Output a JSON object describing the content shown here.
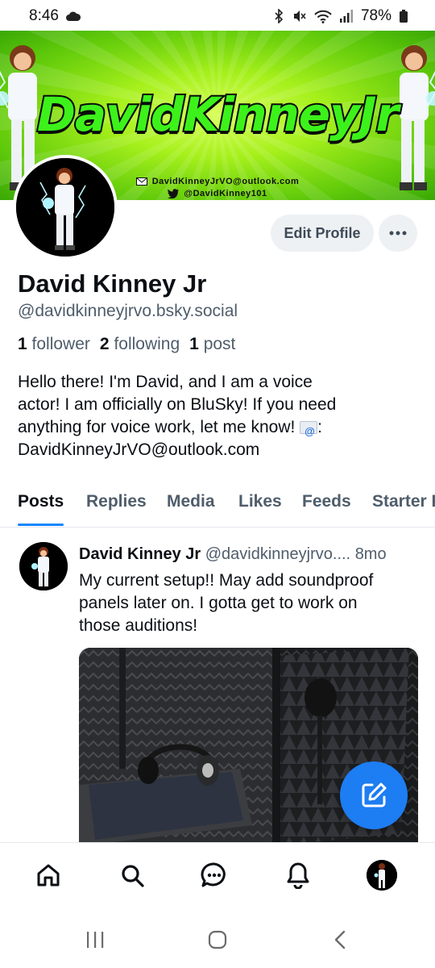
{
  "status_bar": {
    "time": "8:46",
    "battery": "78%",
    "icons": [
      "cloud-icon",
      "bluetooth-icon",
      "mute-icon",
      "wifi-icon",
      "signal-icon",
      "battery-icon"
    ]
  },
  "banner": {
    "title": "DavidKinneyJr",
    "email_line": "DavidKinneyJrVO@outlook.com",
    "twitter_line": "@DavidKinney101",
    "colors": {
      "primary_green": "#3df21a",
      "background": "#a6f01c"
    }
  },
  "profile": {
    "display_name": "David Kinney Jr",
    "handle": "@davidkinneyjrvo.bsky.social",
    "edit_button": "Edit Profile",
    "followers_count": "1",
    "followers_label": "follower",
    "following_count": "2",
    "following_label": "following",
    "posts_count": "1",
    "posts_label": "post",
    "bio_line_1": "Hello there! I'm David, and I am a voice",
    "bio_line_2": "actor! I am officially on BluSky! If you need",
    "bio_line_3_pre": "anything for voice work, let me know! ",
    "bio_line_3_post": ":",
    "bio_line_4": "DavidKinneyJrVO@outlook.com"
  },
  "tabs": [
    {
      "label": "Posts",
      "active": true
    },
    {
      "label": "Replies",
      "active": false
    },
    {
      "label": "Media",
      "active": false
    },
    {
      "label": "Likes",
      "active": false
    },
    {
      "label": "Feeds",
      "active": false
    },
    {
      "label": "Starter Packs",
      "active": false
    }
  ],
  "post": {
    "author": "David Kinney Jr",
    "handle": "@davidkinneyjrvo....",
    "time": "8mo",
    "text_line_1": "My current setup!! May add soundproof",
    "text_line_2": "panels later on. I gotta get to work on",
    "text_line_3": "those auditions!"
  },
  "accent_color": "#1185fe",
  "bottom_nav": [
    "home-icon",
    "search-icon",
    "chat-icon",
    "bell-icon",
    "profile-avatar"
  ],
  "android_nav": [
    "recents-icon",
    "home-circle-icon",
    "back-icon"
  ]
}
